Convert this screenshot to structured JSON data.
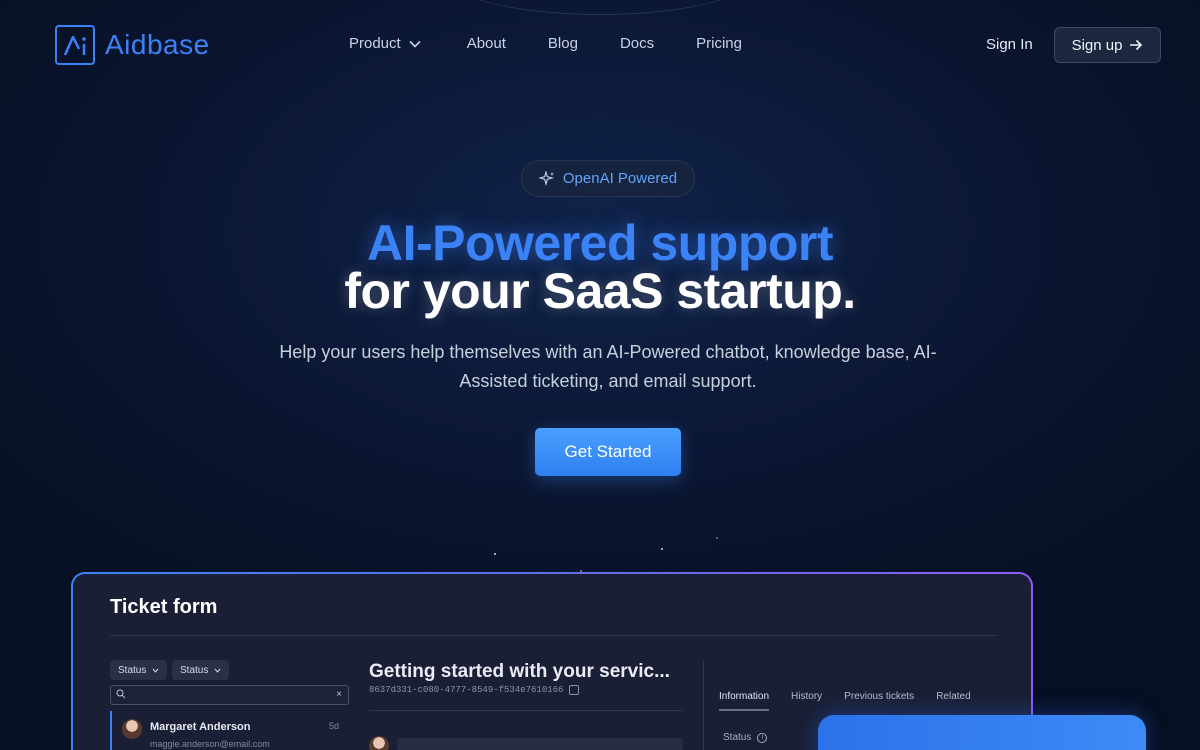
{
  "brand": {
    "name": "Aidbase",
    "accent": "#3b82f6"
  },
  "nav": {
    "links": [
      {
        "label": "Product",
        "has_dropdown": true
      },
      {
        "label": "About"
      },
      {
        "label": "Blog"
      },
      {
        "label": "Docs"
      },
      {
        "label": "Pricing"
      }
    ],
    "sign_in": "Sign In",
    "sign_up": "Sign up"
  },
  "hero": {
    "badge": "OpenAI Powered",
    "headline_line1": "AI-Powered support",
    "headline_line2": "for your SaaS startup.",
    "subtitle": "Help your users help themselves with an AI-Powered chatbot, knowledge base, AI-Assisted ticketing, and email support.",
    "cta": "Get Started"
  },
  "preview": {
    "title": "Ticket form",
    "filters": [
      "Status",
      "Status"
    ],
    "customer": {
      "name": "Margaret Anderson",
      "email": "maggie.anderson@email.com",
      "age": "5d"
    },
    "ticket_title": "Getting started with your servic...",
    "ticket_id": "8637d331-c080-4777-8549-f534e7610166",
    "tabs": [
      "Information",
      "History",
      "Previous tickets",
      "Related"
    ],
    "status_label": "Status"
  },
  "colors": {
    "cta": "#3b82f6",
    "background": "#0b1733",
    "preview_border_start": "#3b82f6",
    "preview_border_end": "#8b5cf6"
  }
}
